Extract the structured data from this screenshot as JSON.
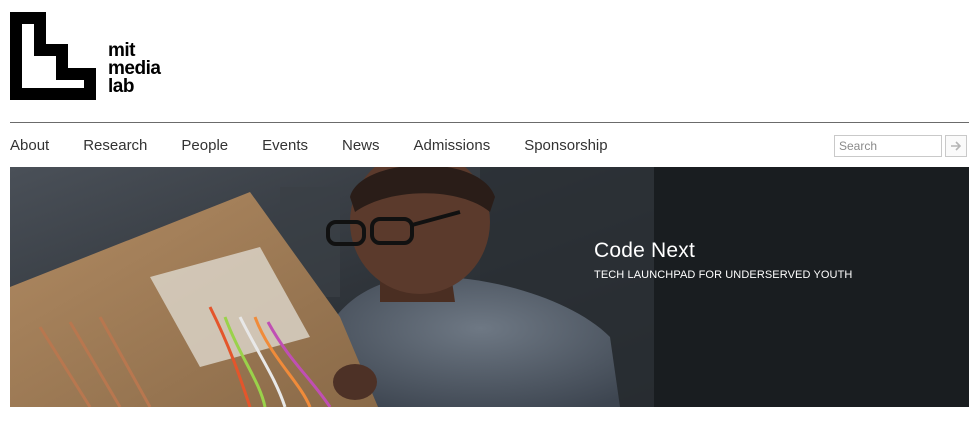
{
  "logo": {
    "line1": "mit",
    "line2": "media",
    "line3": "lab"
  },
  "nav": {
    "items": [
      {
        "label": "About"
      },
      {
        "label": "Research"
      },
      {
        "label": "People"
      },
      {
        "label": "Events"
      },
      {
        "label": "News"
      },
      {
        "label": "Admissions"
      },
      {
        "label": "Sponsorship"
      }
    ]
  },
  "search": {
    "placeholder": "Search",
    "value": ""
  },
  "hero": {
    "title": "Code Next",
    "subtitle": "TECH LAUNCHPAD FOR UNDERSERVED YOUTH"
  },
  "colors": {
    "hero_background": "#191d20",
    "rule": "#6b6b6b",
    "nav_text": "#333333"
  }
}
